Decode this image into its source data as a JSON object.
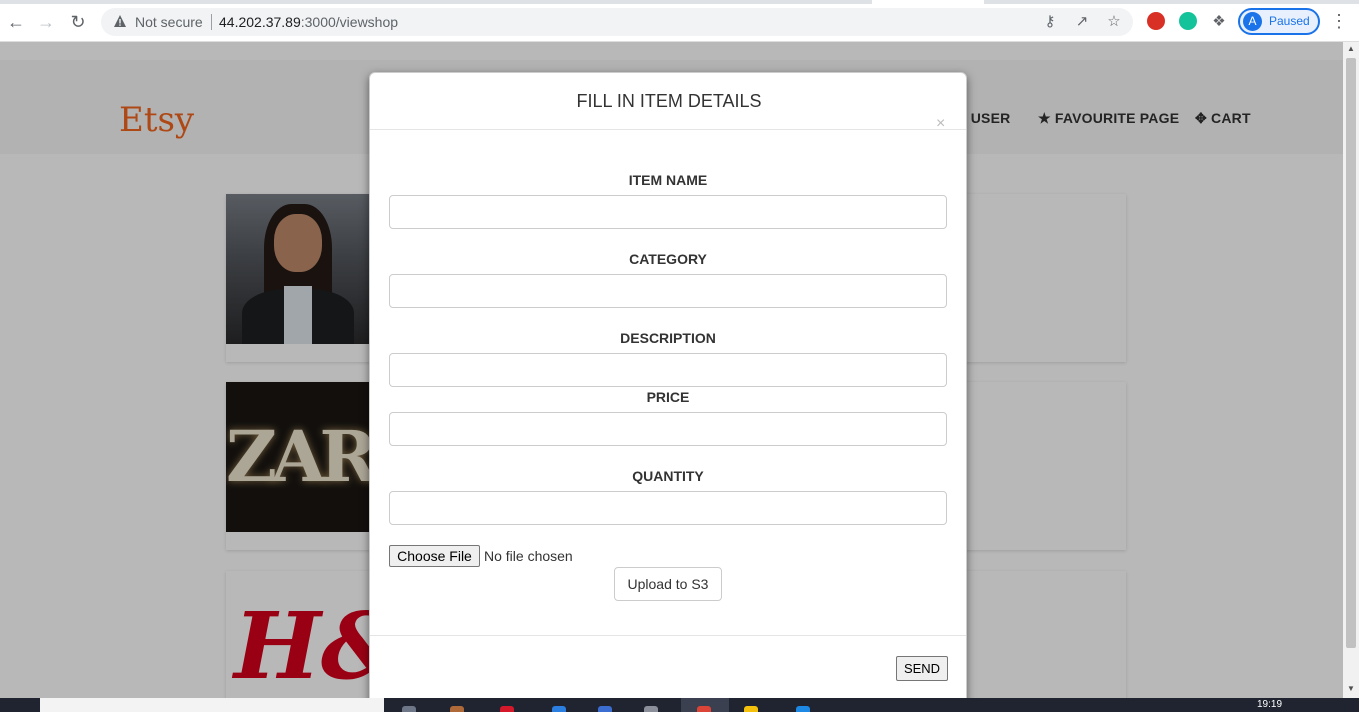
{
  "browser": {
    "security_status": "Not secure",
    "url_host": "44.202.37.89",
    "url_path": ":3000/viewshop",
    "profile_initial": "A",
    "profile_status": "Paused"
  },
  "site": {
    "logo": "Etsy",
    "nav": [
      {
        "label": "USER",
        "icon": "user-icon"
      },
      {
        "label": "FAVOURITE PAGE",
        "icon": "star-icon"
      },
      {
        "label": "CART",
        "icon": "cart-icon"
      }
    ],
    "cards": [
      {
        "image": "person-photo"
      },
      {
        "image": "zara-logo",
        "image_text": "ZARA"
      },
      {
        "image": "hm-logo",
        "image_text": "H&M"
      }
    ]
  },
  "modal": {
    "title": "FILL IN ITEM DETAILS",
    "close_symbol": "×",
    "fields": [
      {
        "label": "ITEM NAME",
        "value": "",
        "placeholder": ""
      },
      {
        "label": "CATEGORY",
        "value": "",
        "placeholder": ""
      },
      {
        "label": "DESCRIPTION",
        "value": "",
        "placeholder": ""
      },
      {
        "label": "PRICE",
        "value": "",
        "placeholder": ""
      },
      {
        "label": "QUANTITY",
        "value": "",
        "placeholder": ""
      }
    ],
    "file_button": "Choose File",
    "file_status": "No file chosen",
    "upload_button": "Upload to S3",
    "send_button": "SEND"
  },
  "taskbar": {
    "time": "19:19"
  },
  "colors": {
    "etsy_orange": "#f1641e",
    "profile_blue": "#1a73e8",
    "overlay": "rgba(0,0,0,0.28)"
  }
}
